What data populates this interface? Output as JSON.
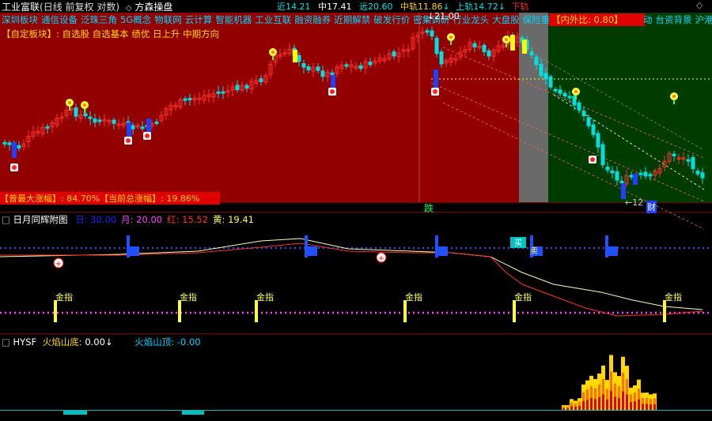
{
  "header": {
    "stock_name": "工业富联",
    "mode": "(日线 前复权 对数)",
    "indicator_name": "方森操盘",
    "legend": {
      "near_label": "近",
      "near_value": "14.21",
      "mid_label": "中",
      "mid_value": "17.41",
      "far_label": "远",
      "far_value": "20.60",
      "zhonggui_label": "中轨",
      "zhonggui_value": "11.86",
      "shanggui_label": "上轨",
      "shanggui_value": "14.72",
      "xiagui_label": "下轨"
    }
  },
  "concepts": [
    "深圳板块",
    "通信设备",
    "泛珠三角",
    "5G概念",
    "物联网",
    "云计算",
    "智能机器",
    "工业互联",
    "融资融券",
    "近期解禁",
    "破发行价",
    "密集调研",
    "行业龙头",
    "大盘股",
    "保险重仓",
    "Q"
  ],
  "concepts_right": [
    "动",
    "台资背景",
    "沪港通"
  ],
  "ratio_box": "【内外比: 0.80】",
  "custom_block": "【自定板块】: 自选股 自选基本 绩优 日上升 中期方向",
  "max_gain_label": "【曾最大涨幅】: ",
  "max_gain_value": "84.70%",
  "cur_gain_label": "【当前总涨幅】: ",
  "cur_gain_value": "19.86%",
  "peak_price": "21.00",
  "low_label": "←12",
  "die_label": "跌",
  "cai_label": "财",
  "sub1": {
    "title": "日月同辉附图",
    "items": [
      {
        "label": "日:",
        "value": "30.00",
        "color": "#2020ff"
      },
      {
        "label": "月:",
        "value": "20.00",
        "color": "#ff40ff"
      },
      {
        "label": "红:",
        "value": "15.52",
        "color": "#ff3030"
      },
      {
        "label": "黄:",
        "value": "19.41",
        "color": "#ffff40"
      }
    ],
    "gold_label": "金指",
    "buy_label": "买",
    "sell_label": "卖"
  },
  "sub2": {
    "title": "HYSF",
    "bottom_label": "火焰山底: ",
    "bottom_value": "0.00",
    "top_label": "火焰山顶: ",
    "top_value": "-0.00"
  },
  "colors": {
    "bg_red": "#920000",
    "bg_green": "#003c00",
    "candle_up": "#ff3030",
    "candle_down": "#00e0e0",
    "accent_yellow": "#ffff00",
    "concept_text": "#00d8ff"
  }
}
